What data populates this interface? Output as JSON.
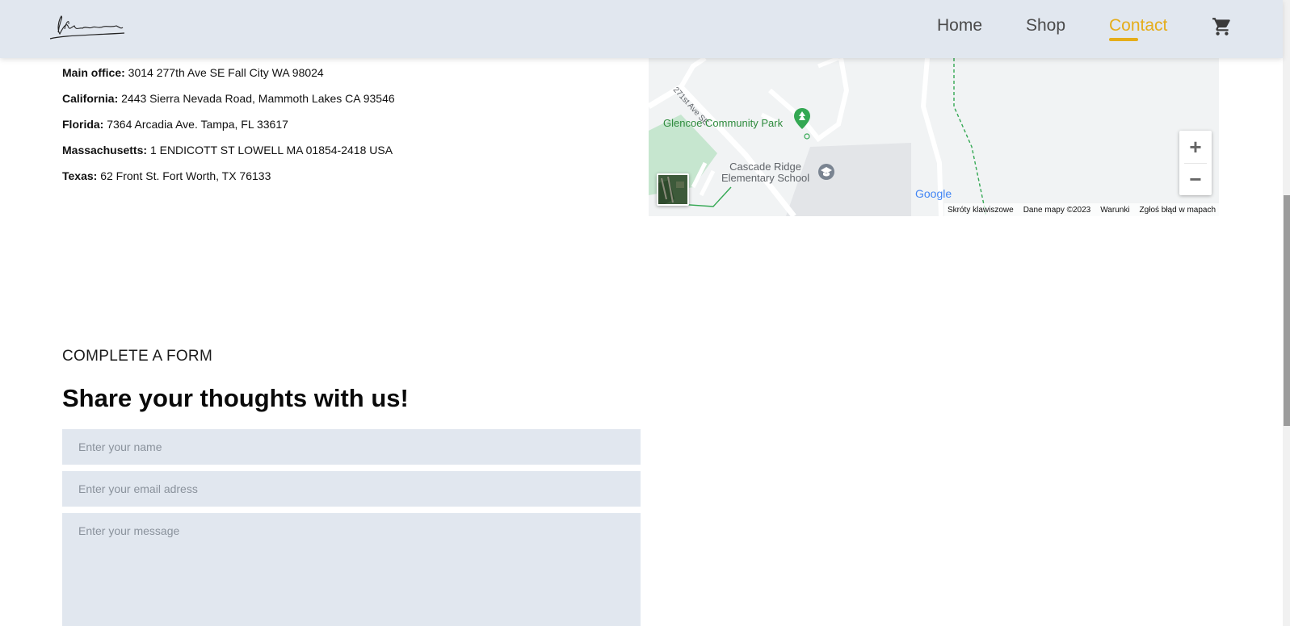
{
  "header": {
    "logo_alt": "Signature logo",
    "nav": {
      "home": "Home",
      "shop": "Shop",
      "contact": "Contact"
    },
    "active_color": "#e5ad1a",
    "cart_icon": "shopping-cart-icon"
  },
  "addresses": [
    {
      "label": "Main office:",
      "text": "3014 277th Ave SE Fall City WA 98024"
    },
    {
      "label": "California:",
      "text": "2443 Sierra Nevada Road, Mammoth Lakes CA 93546"
    },
    {
      "label": "Florida:",
      "text": "7364 Arcadia Ave. Tampa, FL 33617"
    },
    {
      "label": "Massachusetts:",
      "text": "1 ENDICOTT ST LOWELL MA 01854-2418 USA"
    },
    {
      "label": "Texas:",
      "text": "62 Front St. Fort Worth, TX 76133"
    }
  ],
  "map": {
    "park_label": "Glencoe Community Park",
    "school_label_line1": "Cascade Ridge",
    "school_label_line2": "Elementary School",
    "road_label": "271st Ave SE",
    "zoom_in": "+",
    "zoom_out": "−",
    "google": "Google",
    "attribution": {
      "shortcuts": "Skróty klawiszowe",
      "map_data": "Dane mapy ©2023",
      "terms": "Warunki",
      "report": "Zgłoś błąd w mapach"
    }
  },
  "form": {
    "eyebrow": "COMPLETE A FORM",
    "title": "Share your thoughts with us!",
    "name_placeholder": "Enter your name",
    "email_placeholder": "Enter your email adress",
    "message_placeholder": "Enter your message"
  }
}
